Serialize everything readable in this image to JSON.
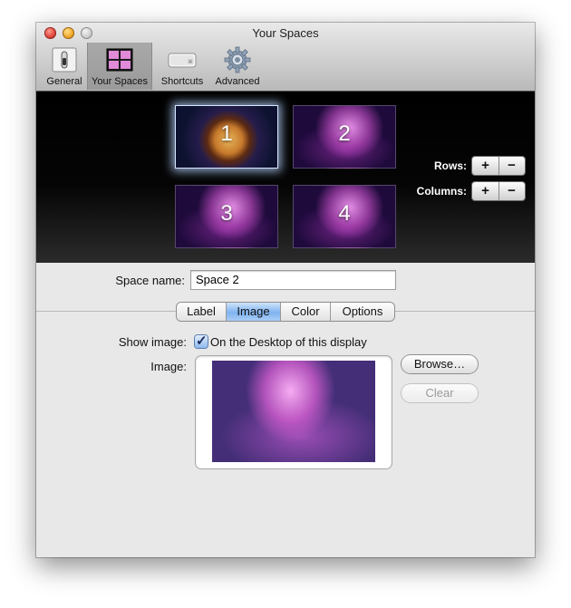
{
  "window": {
    "title": "Your Spaces"
  },
  "toolbar": {
    "items": [
      {
        "label": "General",
        "icon": "general-switch-icon",
        "selected": false
      },
      {
        "label": "Your Spaces",
        "icon": "spaces-grid-icon",
        "selected": true
      },
      {
        "label": "Shortcuts",
        "icon": "keyboard-key-icon",
        "selected": false
      },
      {
        "label": "Advanced",
        "icon": "gear-icon",
        "selected": false
      }
    ]
  },
  "spaces": [
    {
      "number": "1",
      "wallpaper": "sun-nebula",
      "selected": true
    },
    {
      "number": "2",
      "wallpaper": "aurora",
      "selected": false
    },
    {
      "number": "3",
      "wallpaper": "aurora",
      "selected": false
    },
    {
      "number": "4",
      "wallpaper": "aurora",
      "selected": false
    }
  ],
  "grid_controls": {
    "rows_label": "Rows:",
    "columns_label": "Columns:",
    "plus": "+",
    "minus": "−"
  },
  "form": {
    "space_name_label": "Space name:",
    "space_name_value": "Space 2",
    "tabs": [
      {
        "label": "Label",
        "active": false
      },
      {
        "label": "Image",
        "active": true
      },
      {
        "label": "Color",
        "active": false
      },
      {
        "label": "Options",
        "active": false
      }
    ],
    "show_image_label": "Show image:",
    "show_image_checked": true,
    "show_image_option": "On the Desktop of this display",
    "image_label": "Image:",
    "browse_label": "Browse…",
    "clear_label": "Clear"
  },
  "colors": {
    "tab_active": "#7fb3ef",
    "checkbox": "#8eb8ee",
    "close": "#e0443a",
    "minimize": "#f0a72a"
  }
}
